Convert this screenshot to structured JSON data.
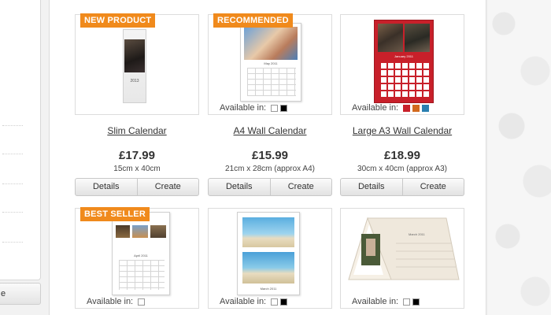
{
  "sidebar": {
    "button_label": "e"
  },
  "products": [
    {
      "badge": "NEW PRODUCT",
      "name": "Slim Calendar",
      "price": "£17.99",
      "size": "15cm x 40cm",
      "available_label": "",
      "art_year": "2013",
      "details": "Details",
      "create": "Create"
    },
    {
      "badge": "RECOMMENDED",
      "name": "A4 Wall Calendar",
      "price": "£15.99",
      "size": "21cm x 28cm (approx A4)",
      "available_label": "Available in:",
      "art_month": "May 2011",
      "details": "Details",
      "create": "Create"
    },
    {
      "badge": "",
      "name": "Large A3 Wall Calendar",
      "price": "£18.99",
      "size": "30cm x 40cm (approx A3)",
      "available_label": "Available in:",
      "art_month": "January 2011",
      "details": "Details",
      "create": "Create"
    },
    {
      "badge": "BEST SELLER",
      "available_label": "Available in:",
      "art_month": "April 2011"
    },
    {
      "badge": "",
      "available_label": "Available in:",
      "art_month": "March 2011"
    },
    {
      "badge": "",
      "available_label": "Available in:",
      "art_month": "March 2011"
    }
  ],
  "colors": {
    "badge": "#f08a1c",
    "swatch_white": "#ffffff",
    "swatch_black": "#000000",
    "swatch_red": "#c8202a",
    "swatch_orange": "#d2691e",
    "swatch_blue": "#2a7fb0"
  }
}
